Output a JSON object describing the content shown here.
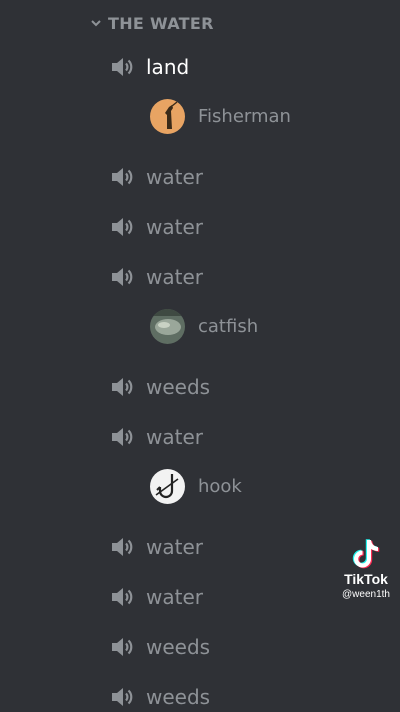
{
  "category": {
    "label": "THE WATER"
  },
  "channels": [
    {
      "name": "land",
      "active": true
    },
    {
      "name": "water"
    },
    {
      "name": "water"
    },
    {
      "name": "water"
    },
    {
      "name": "weeds"
    },
    {
      "name": "water"
    },
    {
      "name": "water"
    },
    {
      "name": "water"
    },
    {
      "name": "weeds"
    },
    {
      "name": "weeds"
    }
  ],
  "members": [
    {
      "name": "Fisherman",
      "avatar_icon": "fisherman-avatar"
    },
    {
      "name": "catfish",
      "avatar_icon": "catfish-avatar"
    },
    {
      "name": "hook",
      "avatar_icon": "hook-avatar"
    }
  ],
  "watermark": {
    "brand": "TikTok",
    "user": "@ween1th"
  },
  "colors": {
    "background": "#2f3136",
    "muted_text": "#8e9297",
    "active_text": "#ffffff"
  }
}
